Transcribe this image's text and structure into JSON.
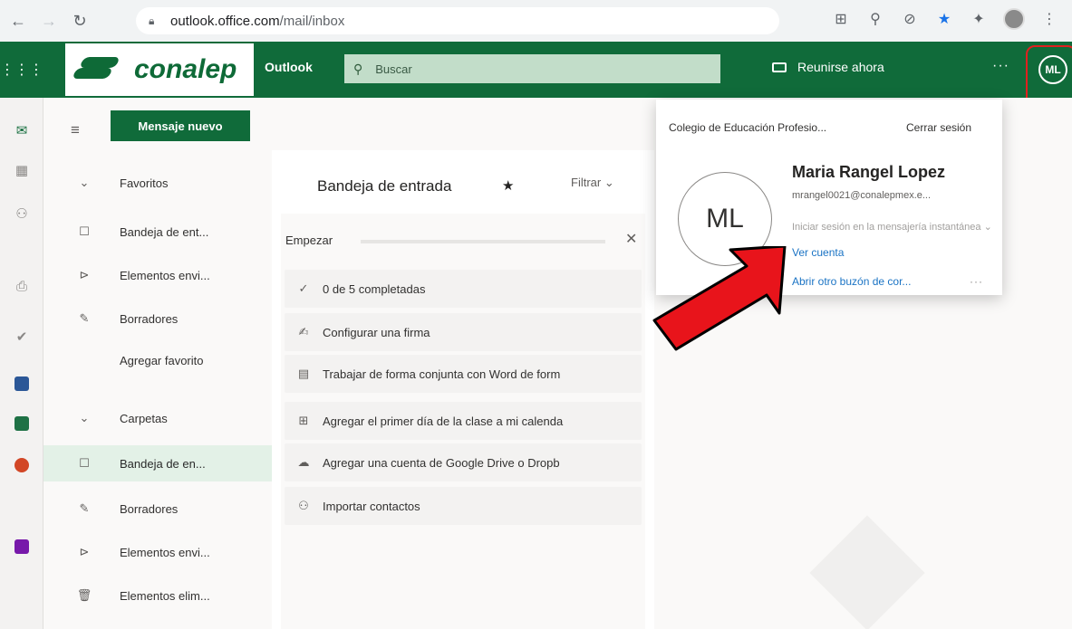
{
  "browser": {
    "url_host": "outlook.office.com",
    "url_path": "/mail/inbox"
  },
  "header": {
    "logo_text": "conalep",
    "app_name": "Outlook",
    "search_placeholder": "Buscar",
    "meet_now": "Reunirse ahora",
    "more": "···",
    "avatar_initials": "ML"
  },
  "folders": {
    "new_message": "Mensaje nuevo",
    "items": [
      {
        "label": "Favoritos",
        "icon": "chevron-down-icon",
        "glyph": "⌄"
      },
      {
        "label": "Bandeja de ent...",
        "icon": "inbox-icon",
        "glyph": "☐"
      },
      {
        "label": "Elementos envi...",
        "icon": "send-icon",
        "glyph": "⊳"
      },
      {
        "label": "Borradores",
        "icon": "pencil-icon",
        "glyph": "✎"
      },
      {
        "label": "Agregar favorito",
        "icon": "",
        "glyph": ""
      },
      {
        "label": "Carpetas",
        "icon": "chevron-down-icon",
        "glyph": "⌄"
      },
      {
        "label": "Bandeja de en...",
        "icon": "inbox-icon",
        "glyph": "☐"
      },
      {
        "label": "Borradores",
        "icon": "pencil-icon",
        "glyph": "✎"
      },
      {
        "label": "Elementos envi...",
        "icon": "send-icon",
        "glyph": "⊳"
      },
      {
        "label": "Elementos elim...",
        "icon": "trash-icon",
        "glyph": "🗑"
      }
    ]
  },
  "mail": {
    "title": "Bandeja de entrada",
    "filter": "Filtrar ⌄",
    "start_title": "Empezar",
    "tasks": [
      {
        "label": "0 de 5 completadas",
        "icon": "check-icon",
        "glyph": "✓"
      },
      {
        "label": "Configurar una firma",
        "icon": "signature-icon",
        "glyph": "✍"
      },
      {
        "label": "Trabajar de forma conjunta con Word de form",
        "icon": "document-icon",
        "glyph": "▤"
      },
      {
        "label": "Agregar el primer día de la clase a mi calenda",
        "icon": "calendar-add-icon",
        "glyph": "⊞"
      },
      {
        "label": "Agregar una cuenta de Google Drive o Dropb",
        "icon": "cloud-icon",
        "glyph": "☁"
      },
      {
        "label": "Importar contactos",
        "icon": "contacts-icon",
        "glyph": "⚇"
      }
    ]
  },
  "account": {
    "organization": "Colegio de Educación Profesio...",
    "sign_out": "Cerrar sesión",
    "initials": "ML",
    "name": "Maria Rangel Lopez",
    "email": "mrangel0021@conalepmex.e...",
    "im_signin": "Iniciar sesión en la mensajería instantánea ⌄",
    "view_account": "Ver cuenta",
    "open_mailbox": "Abrir otro buzón de cor...",
    "more": "···"
  },
  "colors": {
    "brand_green": "#106b3a",
    "link_blue": "#1a73c4",
    "highlight_red": "#e0201f"
  }
}
